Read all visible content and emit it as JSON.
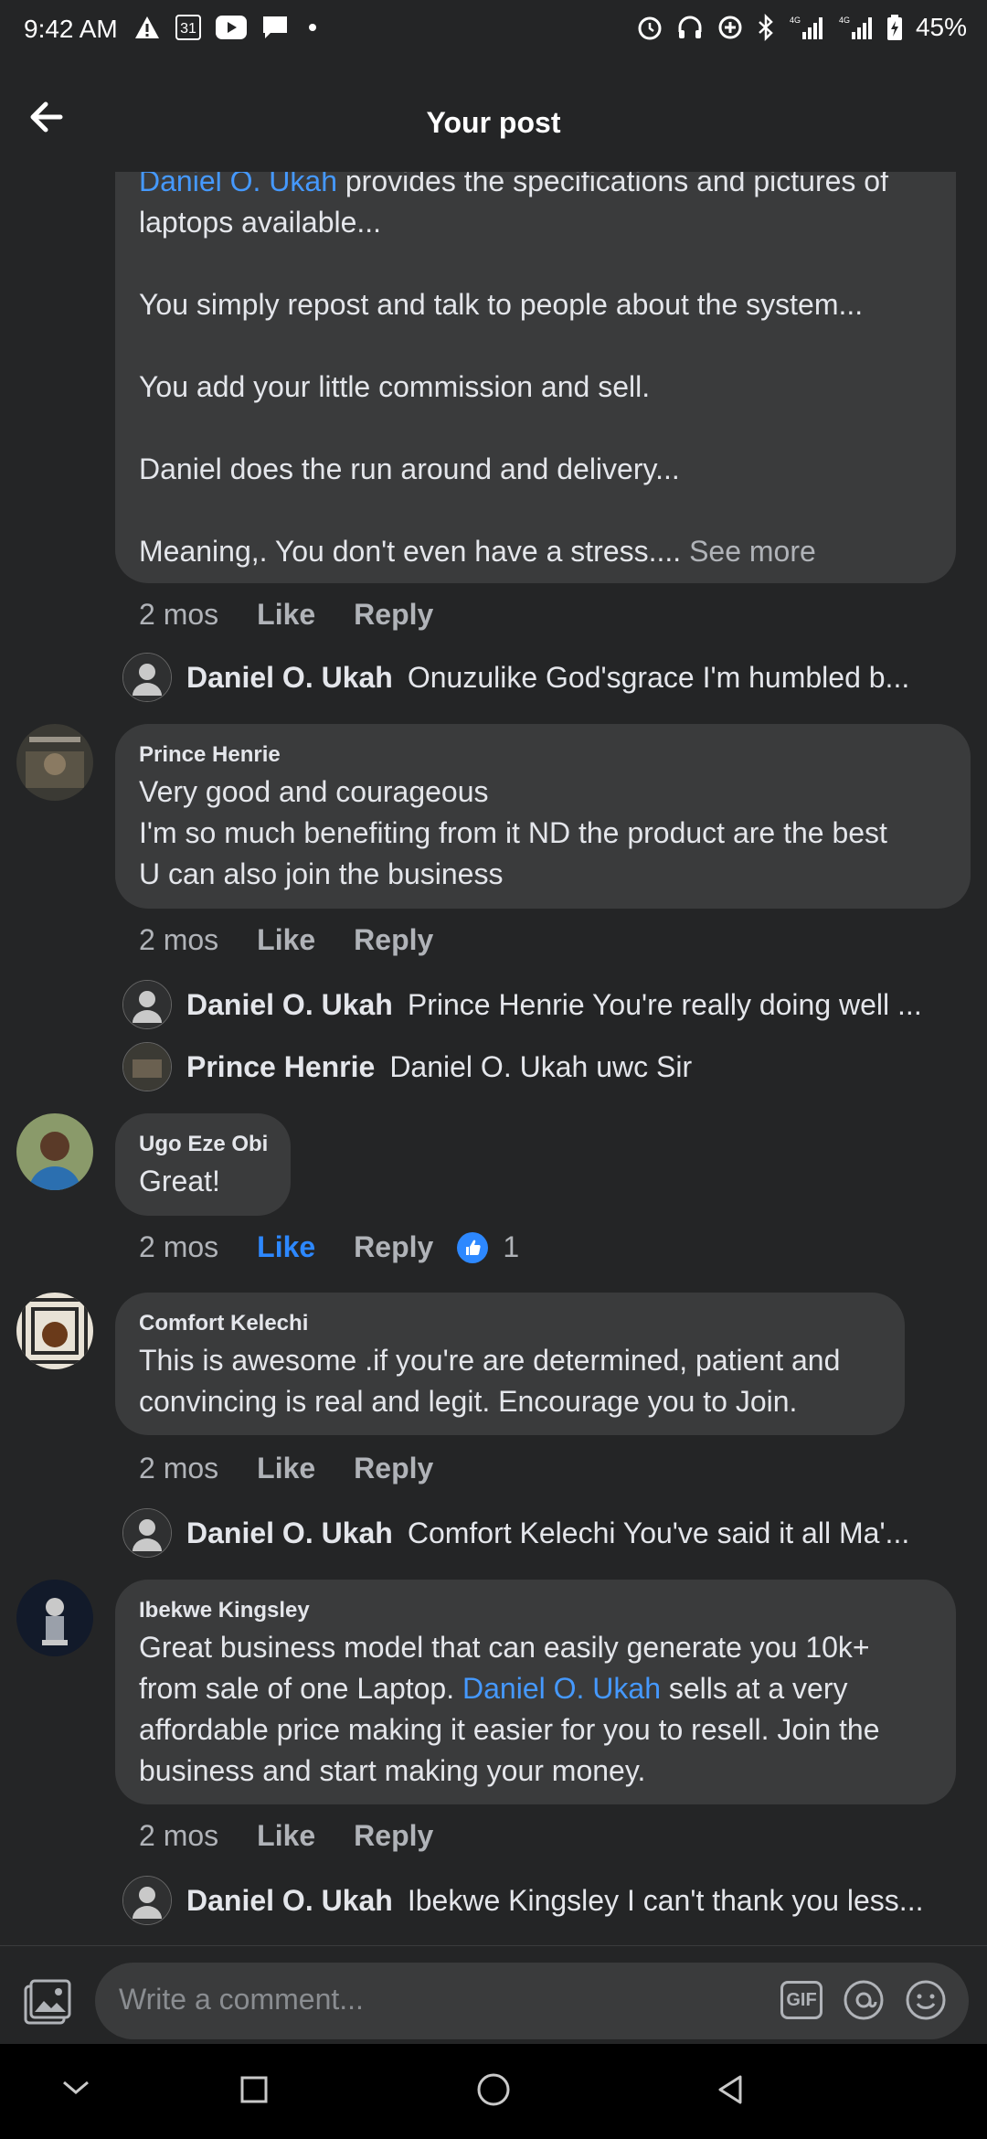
{
  "status_bar": {
    "time": "9:42 AM",
    "calendar_day": "31",
    "battery": "45%"
  },
  "header": {
    "title": "Your post"
  },
  "comments": [
    {
      "partial_text_link": "Daniel O. Ukah",
      "partial_text_rest": " provides the specifications and pictures of",
      "lines": [
        "laptops available...",
        "",
        "You simply repost and talk to people about the system...",
        "",
        "You add your little commission and sell.",
        "",
        "Daniel does the run around and delivery...",
        ""
      ],
      "last_line": "Meaning,. You don't even have a stress....",
      "see_more": "See more",
      "time": "2 mos",
      "like": "Like",
      "reply": "Reply",
      "replies": [
        {
          "name": "Daniel O. Ukah",
          "text": "Onuzulike God'sgrace  I'm humbled b..."
        }
      ]
    },
    {
      "name": "Prince Henrie",
      "lines": [
        "Very good and courageous",
        "I'm so much benefiting from it ND the product are the best",
        "U can also join the business"
      ],
      "time": "2 mos",
      "like": "Like",
      "reply": "Reply",
      "replies": [
        {
          "name": "Daniel O. Ukah",
          "text": "Prince Henrie You're really doing well ..."
        },
        {
          "name": "Prince Henrie",
          "text": "Daniel O. Ukah uwc Sir"
        }
      ]
    },
    {
      "name": "Ugo Eze Obi",
      "lines": [
        "Great!"
      ],
      "time": "2 mos",
      "like": "Like",
      "reply": "Reply",
      "reaction_count": "1"
    },
    {
      "name": "Comfort Kelechi",
      "lines": [
        "This is awesome .if you're are determined, patient and",
        "convincing is real and legit. Encourage you to Join."
      ],
      "time": "2 mos",
      "like": "Like",
      "reply": "Reply",
      "replies": [
        {
          "name": "Daniel O. Ukah",
          "text": "Comfort Kelechi You've said it all Ma'..."
        }
      ]
    },
    {
      "name": "Ibekwe Kingsley",
      "line1": "Great business model that can easily generate you 10k+",
      "line2_pre": "from sale of one Laptop. ",
      "line2_link": "Daniel O. Ukah",
      "line2_post": " sells at a very",
      "line3": "affordable price making it easier for you to resell. Join the",
      "line4": "business and start making your money.",
      "time": "2 mos",
      "like": "Like",
      "reply": "Reply",
      "replies": [
        {
          "name": "Daniel O. Ukah",
          "text": "Ibekwe Kingsley I can't thank you less..."
        }
      ]
    }
  ],
  "composer": {
    "placeholder": "Write a comment...",
    "gif_label": "GIF"
  },
  "colors": {
    "background": "#242526",
    "bubble": "#3a3b3c",
    "link": "#4599ff",
    "like_active": "#2d88ff"
  }
}
